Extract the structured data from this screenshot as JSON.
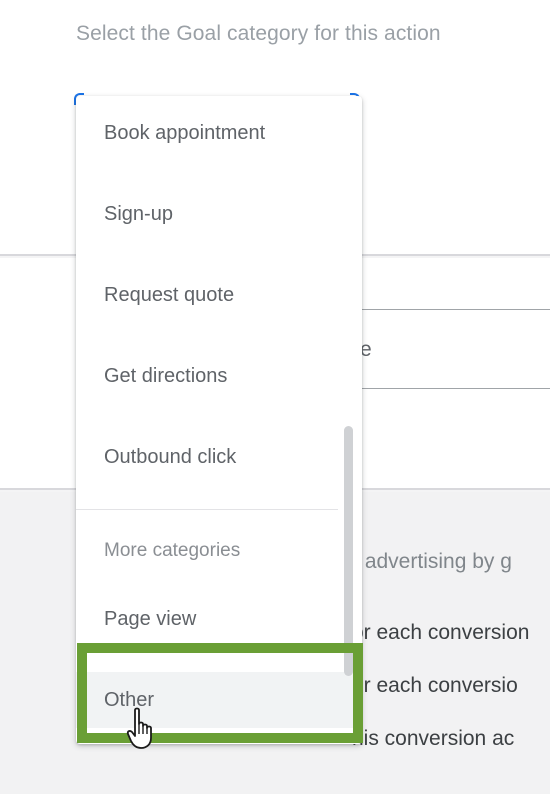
{
  "dialog": {
    "prompt": "Select the Goal category for this action",
    "value_field_text": "e"
  },
  "menu": {
    "items": [
      {
        "label": "Book appointment"
      },
      {
        "label": "Sign-up"
      },
      {
        "label": "Request quote"
      },
      {
        "label": "Get directions"
      },
      {
        "label": "Outbound click"
      }
    ],
    "section_label": "More categories",
    "extra_items": [
      {
        "label": "Page view"
      },
      {
        "label": "Other"
      }
    ]
  },
  "background_lines": {
    "line1": "r advertising by g",
    "line2": "or each conversion",
    "line3": "or each conversio",
    "line4": "his conversion ac"
  },
  "annotation": {
    "highlight_color": "#6a9f35",
    "cursor_icon": "pointer-hand-icon"
  }
}
